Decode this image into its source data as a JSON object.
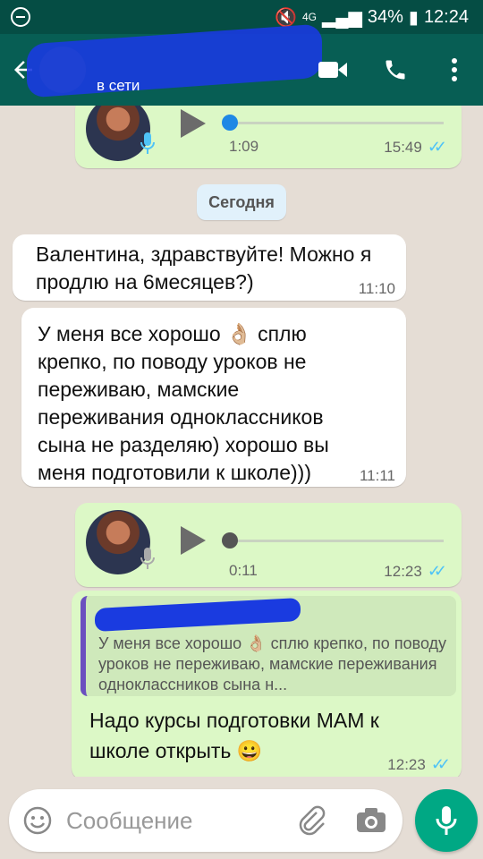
{
  "status_bar": {
    "network": "4G",
    "battery": "34%",
    "time": "12:24"
  },
  "header": {
    "status": "в сети",
    "icons": [
      "back-arrow-icon",
      "video-call-icon",
      "phone-icon",
      "more-vert-icon"
    ]
  },
  "chat": {
    "voice_1": {
      "duration": "1:09",
      "time": "15:49"
    },
    "date_chip": "Сегодня",
    "msg_1": {
      "text": "Валентина, здравствуйте! Можно я продлю на 6месяцев?)",
      "time": "11:10"
    },
    "msg_2": {
      "text": "У меня все хорошо 👌🏼 сплю крепко, по поводу уроков не переживаю, мамские переживания одноклассников сына не разделяю) хорошо вы меня подготовили к школе)))",
      "time": "11:11"
    },
    "voice_2": {
      "duration": "0:11",
      "time": "12:23"
    },
    "reply": {
      "quote": "У меня все хорошо 👌🏼 сплю крепко, по поводу уроков не переживаю, мамские переживания одноклассников сына н...",
      "text": "Надо курсы подготовки МАМ к школе открыть 😀",
      "time": "12:23"
    }
  },
  "input": {
    "placeholder": "Сообщение"
  },
  "colors": {
    "header": "#075e54",
    "status_bar": "#054d44",
    "outgoing": "#dcf8c6",
    "incoming": "#ffffff",
    "accent": "#00a884",
    "ticks": "#4fc3f7"
  }
}
